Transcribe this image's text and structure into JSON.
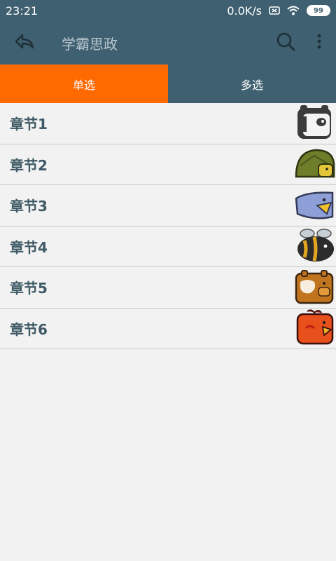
{
  "status": {
    "time": "23:21",
    "speed": "0.0K/s",
    "battery": "99"
  },
  "app_bar": {
    "title": "学霸思政"
  },
  "tabs": [
    {
      "label": "单选",
      "active": true
    },
    {
      "label": "多选",
      "active": false
    }
  ],
  "chapters": [
    {
      "label": "章节1",
      "icon": "panda-icon"
    },
    {
      "label": "章节2",
      "icon": "turtle-icon"
    },
    {
      "label": "章节3",
      "icon": "bird-icon"
    },
    {
      "label": "章节4",
      "icon": "bee-icon"
    },
    {
      "label": "章节5",
      "icon": "cow-icon"
    },
    {
      "label": "章节6",
      "icon": "chicken-icon"
    }
  ],
  "colors": {
    "primary": "#3f6070",
    "accent": "#ff6a00",
    "background": "#f2f2f2"
  }
}
